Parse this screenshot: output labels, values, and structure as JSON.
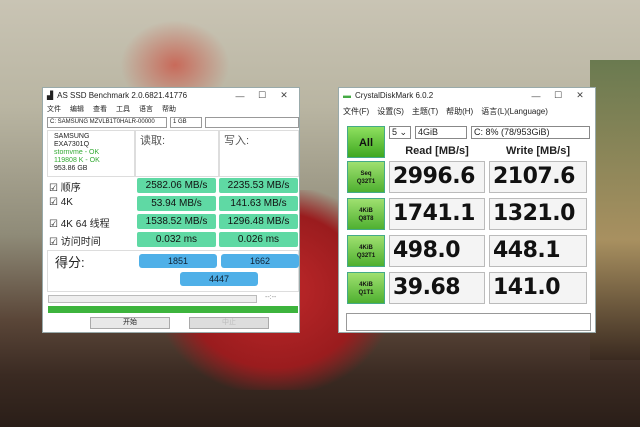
{
  "as_ssd": {
    "title": "AS SSD Benchmark 2.0.6821.41776",
    "menu": [
      "文件",
      "编辑",
      "查看",
      "工具",
      "语言",
      "帮助"
    ],
    "drive_select": "C: SAMSUNG MZVLB1T0HALR-00000",
    "size_select": "1 GB",
    "drive_info": [
      "SAMSUNG",
      "EXA7301Q",
      "stornvme - OK",
      "119808 K - OK",
      "953.86 GB"
    ],
    "read_header": "读取:",
    "write_header": "写入:",
    "rows": [
      {
        "label": "顺序",
        "read": "2582.06 MB/s",
        "write": "2235.53 MB/s"
      },
      {
        "label": "4K",
        "read": "53.94 MB/s",
        "write": "141.63 MB/s"
      },
      {
        "label": "4K 64 线程",
        "read": "1538.52 MB/s",
        "write": "1296.48 MB/s"
      },
      {
        "label": "访问时间",
        "read": "0.032 ms",
        "write": "0.026 ms"
      }
    ],
    "checkbox": "☑",
    "score_label": "得分:",
    "score_read": "1851",
    "score_write": "1662",
    "score_total": "4447",
    "progress_time": "--:--",
    "start_button": "开始",
    "abort_button": "中止"
  },
  "cdm": {
    "title": "CrystalDiskMark 6.0.2",
    "menu": [
      "文件(F)",
      "设置(S)",
      "主题(T)",
      "帮助(H)",
      "语言(L)(Language)"
    ],
    "all_button": "All",
    "count": "5",
    "size": "4GiB",
    "drive": "C: 8% (78/953GiB)",
    "read_header": "Read [MB/s]",
    "write_header": "Write [MB/s]",
    "rows": [
      {
        "l1": "Seq",
        "l2": "Q32T1",
        "read": "2996.6",
        "write": "2107.6"
      },
      {
        "l1": "4KiB",
        "l2": "Q8T8",
        "read": "1741.1",
        "write": "1321.0"
      },
      {
        "l1": "4KiB",
        "l2": "Q32T1",
        "read": "498.0",
        "write": "448.1"
      },
      {
        "l1": "4KiB",
        "l2": "Q1T1",
        "read": "39.68",
        "write": "141.0"
      }
    ]
  },
  "window_controls": {
    "min": "—",
    "max": "☐",
    "close": "✕"
  }
}
